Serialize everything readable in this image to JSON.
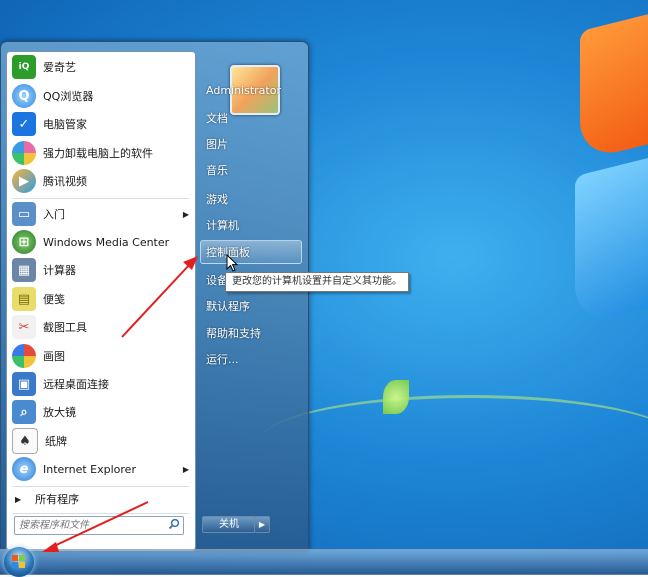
{
  "start_menu": {
    "pinned_programs": [
      {
        "label": "爱奇艺",
        "icon": "iqiyi-icon",
        "color": "#2a9d2a"
      },
      {
        "label": "QQ浏览器",
        "icon": "qq-browser-icon",
        "color": "#2f8ae0"
      },
      {
        "label": "电脑管家",
        "icon": "pc-manager-icon",
        "color": "#1b74e0"
      },
      {
        "label": "强力卸载电脑上的软件",
        "icon": "uninstall-icon",
        "color": "#e86aa6"
      },
      {
        "label": "腾讯视频",
        "icon": "tencent-video-icon",
        "color": "#2c9de6"
      }
    ],
    "recent_programs": [
      {
        "label": "入门",
        "icon": "getting-started-icon",
        "color": "#5a8fc7",
        "has_submenu": true
      },
      {
        "label": "Windows Media Center",
        "icon": "media-center-icon",
        "color": "#3c9a3c"
      },
      {
        "label": "计算器",
        "icon": "calculator-icon",
        "color": "#6b86a6"
      },
      {
        "label": "便笺",
        "icon": "sticky-notes-icon",
        "color": "#d9c94a"
      },
      {
        "label": "截图工具",
        "icon": "snipping-tool-icon",
        "color": "#d33a3a"
      },
      {
        "label": "画图",
        "icon": "paint-icon",
        "color": "#e8a53a"
      },
      {
        "label": "远程桌面连接",
        "icon": "remote-desktop-icon",
        "color": "#3a7ac9"
      },
      {
        "label": "放大镜",
        "icon": "magnifier-icon",
        "color": "#4a8ad0"
      },
      {
        "label": "纸牌",
        "icon": "solitaire-icon",
        "color": "#5a5a5a"
      },
      {
        "label": "Internet Explorer",
        "icon": "internet-explorer-icon",
        "color": "#2b7bd6",
        "has_submenu": true
      }
    ],
    "all_programs": "所有程序",
    "search_placeholder": "搜索程序和文件",
    "right_items": [
      "Administrator",
      "文档",
      "图片",
      "音乐",
      "游戏",
      "计算机",
      "控制面板",
      "设备",
      "默认程序",
      "帮助和支持",
      "运行..."
    ],
    "shutdown_label": "关机",
    "tooltip": "更改您的计算机设置并自定义其功能。"
  }
}
